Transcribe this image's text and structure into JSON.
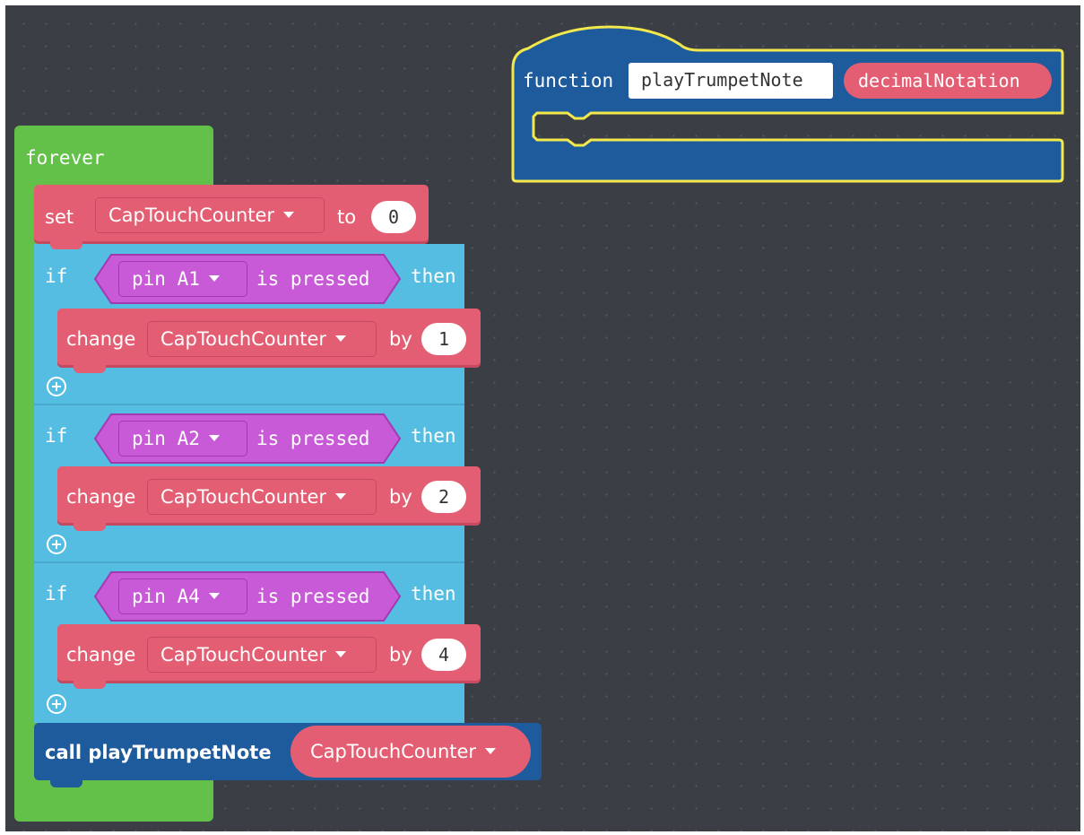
{
  "forever": {
    "label": "forever"
  },
  "set_block": {
    "set_label": "set",
    "variable": "CapTouchCounter",
    "to_label": "to",
    "value": "0"
  },
  "if_blocks": [
    {
      "if_label": "if",
      "pin": "pin A1",
      "is_pressed": "is pressed",
      "then_label": "then",
      "change_label": "change",
      "variable": "CapTouchCounter",
      "by_label": "by",
      "amount": "1"
    },
    {
      "if_label": "if",
      "pin": "pin A2",
      "is_pressed": "is pressed",
      "then_label": "then",
      "change_label": "change",
      "variable": "CapTouchCounter",
      "by_label": "by",
      "amount": "2"
    },
    {
      "if_label": "if",
      "pin": "pin A4",
      "is_pressed": "is pressed",
      "then_label": "then",
      "change_label": "change",
      "variable": "CapTouchCounter",
      "by_label": "by",
      "amount": "4"
    }
  ],
  "call_block": {
    "label": "call playTrumpetNote",
    "argument": "CapTouchCounter"
  },
  "function_block": {
    "keyword": "function",
    "name": "playTrumpetNote",
    "parameter": "decimalNotation"
  },
  "colors": {
    "workspace": "#3b3e45",
    "loops": "#63c14a",
    "variables": "#e35e73",
    "logic": "#56bde2",
    "input": "#c85ad7",
    "functions": "#1e5b9c",
    "selection": "#f3e84b"
  }
}
